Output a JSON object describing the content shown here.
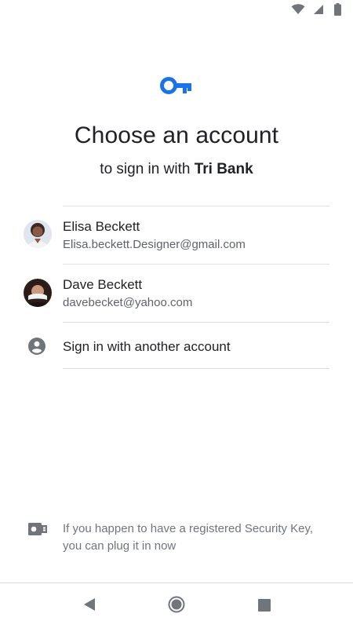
{
  "colors": {
    "accent": "#1a73e8",
    "text_primary": "#202124",
    "text_secondary": "#5f6368",
    "divider": "#e0e0e0",
    "icon_gray": "#70757a"
  },
  "status_bar": {
    "icons": [
      "wifi-icon",
      "signal-icon",
      "battery-icon"
    ]
  },
  "header": {
    "icon": "key-icon",
    "title": "Choose an account",
    "subtitle_prefix": "to sign in with ",
    "app_name": "Tri Bank"
  },
  "accounts": [
    {
      "name": "Elisa Beckett",
      "email": "Elisa.beckett.Designer@gmail.com"
    },
    {
      "name": "Dave Beckett",
      "email": "davebecket@yahoo.com"
    }
  ],
  "another_account": {
    "icon": "account-circle-icon",
    "label": "Sign in with another account"
  },
  "security_key": {
    "icon": "security-key-icon",
    "text": "If you happen to have a registered Security Key, you can plug it in now"
  },
  "nav_bar": {
    "buttons": [
      "back-icon",
      "home-icon",
      "recents-icon"
    ]
  }
}
